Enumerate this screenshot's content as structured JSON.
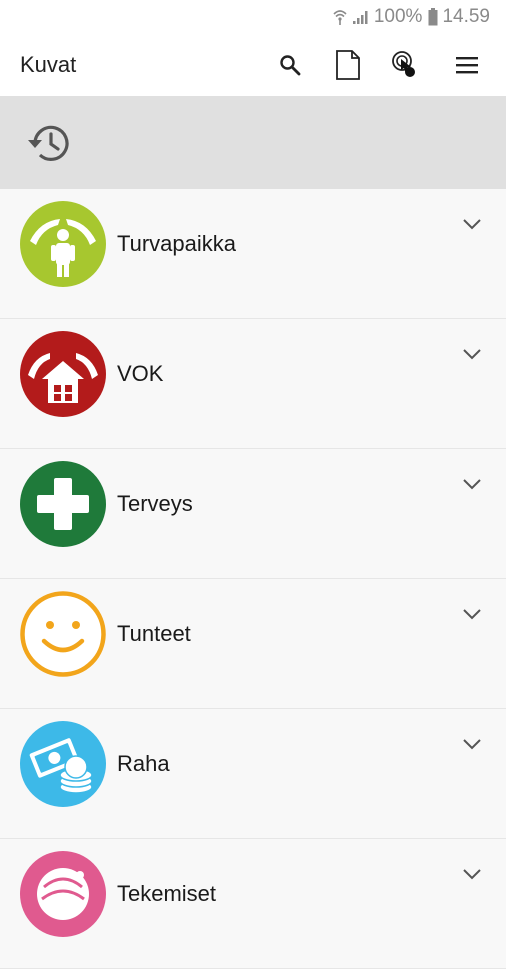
{
  "status_bar": {
    "battery": "100%",
    "time": "14.59"
  },
  "app_bar": {
    "title": "Kuvat",
    "actions": [
      "search-icon",
      "document-icon",
      "touch-icon",
      "menu-icon"
    ]
  },
  "history": {
    "icon": "history-icon"
  },
  "categories": [
    {
      "label": "Turvapaikka",
      "icon": "shelter-person-icon",
      "color": "#a7c72f"
    },
    {
      "label": "VOK",
      "icon": "house-hands-icon",
      "color": "#b31b1b"
    },
    {
      "label": "Terveys",
      "icon": "health-cross-icon",
      "color": "#1f7a3a"
    },
    {
      "label": "Tunteet",
      "icon": "smiley-icon",
      "color": "#f2a51b"
    },
    {
      "label": "Raha",
      "icon": "money-icon",
      "color": "#3db9e8"
    },
    {
      "label": "Tekemiset",
      "icon": "activities-icon",
      "color": "#e05a8f"
    }
  ]
}
